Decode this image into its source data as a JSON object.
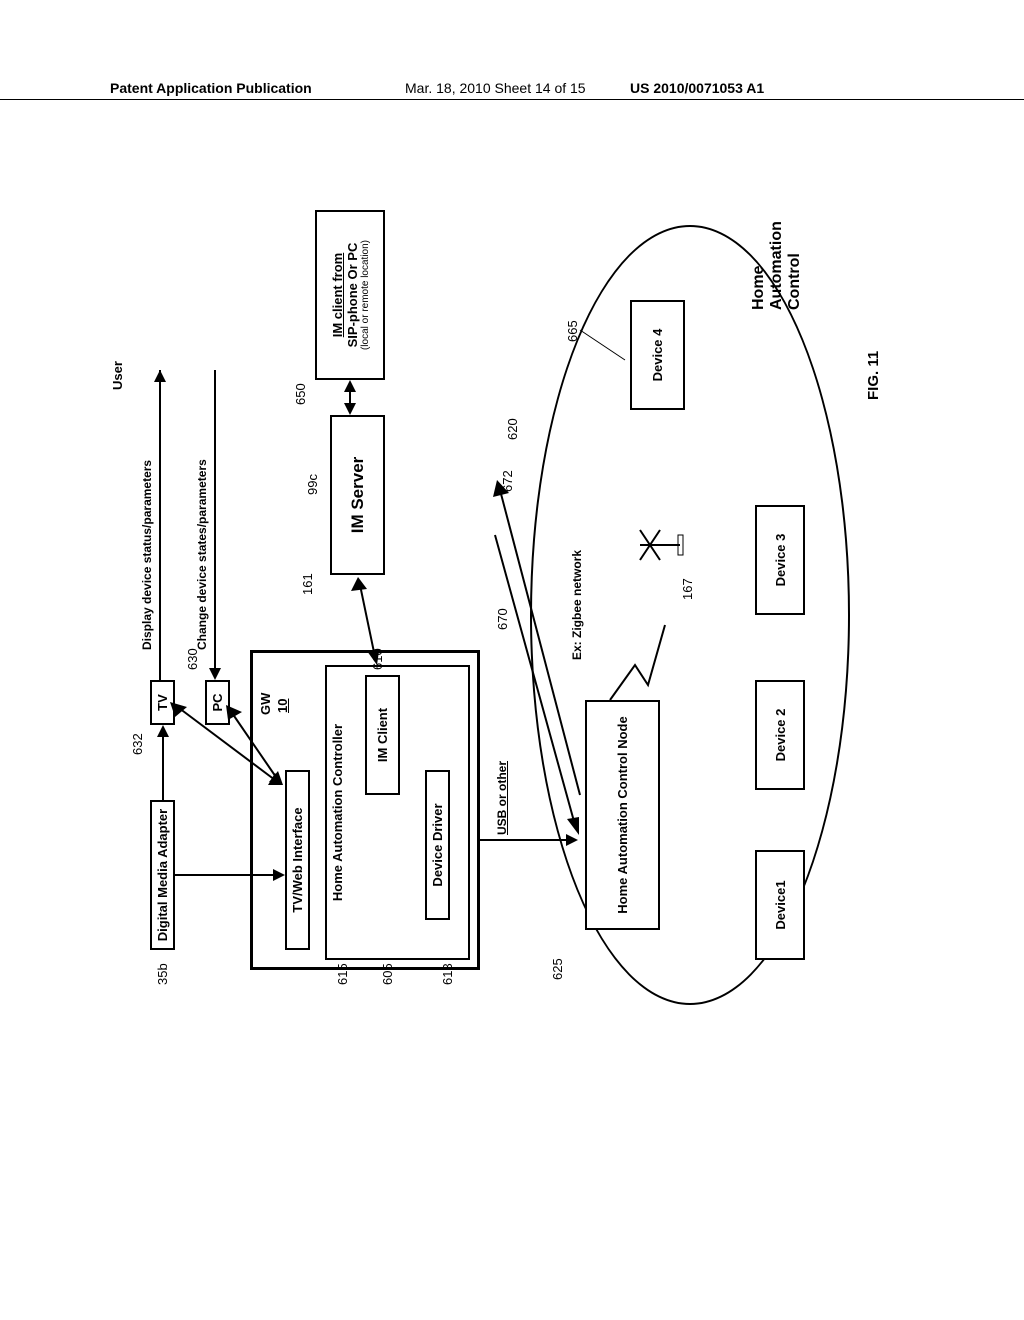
{
  "header": {
    "left": "Patent Application Publication",
    "mid": "Mar. 18, 2010  Sheet 14 of 15",
    "right": "US 2010/0071053 A1"
  },
  "labels": {
    "user": "User",
    "display": "Display device status/parameters",
    "change": "Change device states/parameters",
    "gw": "GW",
    "gwnum": "10",
    "usb": "USB or other",
    "zigbee": "Ex: Zigbee network",
    "hac_title": "Home Automation Control",
    "fig": "FIG. 11"
  },
  "boxes": {
    "dma": "Digital Media Adapter",
    "tv": "TV",
    "pc": "PC",
    "tvweb": "TV/Web Interface",
    "hac": "Home Automation Controller",
    "imclient": "IM Client",
    "devdrv": "Device Driver",
    "imserver": "IM Server",
    "imclient_remote_l1": "IM client from",
    "imclient_remote_l2": "SIP-phone Or PC",
    "imclient_remote_l3": "(local or remote location)",
    "ctrlnode": "Home Automation Control Node",
    "dev1": "Device1",
    "dev2": "Device 2",
    "dev3": "Device 3",
    "dev4": "Device 4"
  },
  "refs": {
    "r35b": "35b",
    "r632": "632",
    "r630": "630",
    "r615": "615",
    "r605": "605",
    "r613": "613",
    "r610": "610",
    "r161": "161",
    "r99c": "99c",
    "r650": "650",
    "r670": "670",
    "r672": "672",
    "r620": "620",
    "r625": "625",
    "r167": "167",
    "r665": "665"
  }
}
